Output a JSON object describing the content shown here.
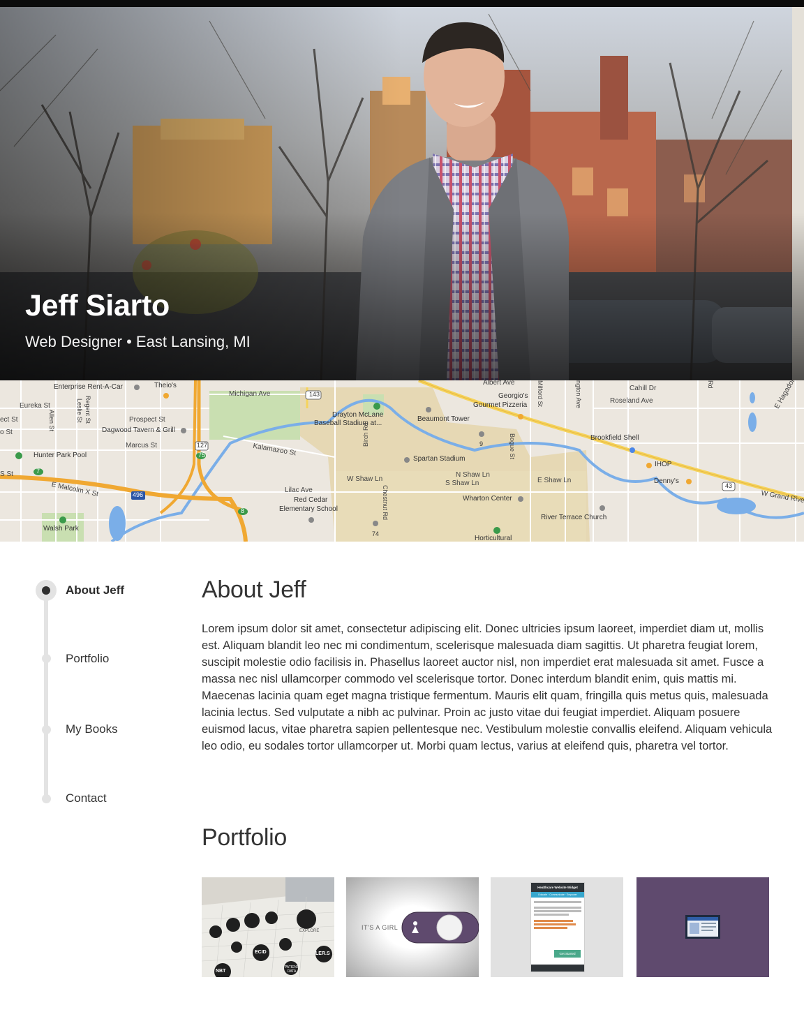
{
  "hero": {
    "name": "Jeff Siarto",
    "subtitle": "Web Designer • East Lansing, MI"
  },
  "map": {
    "labels": {
      "enterprise": "Enterprise Rent-A-Car",
      "theios": "Theio's",
      "michigan_ave": "Michigan Ave",
      "route_143": "143",
      "albert_ave": "Albert Ave",
      "georgios": "Georgio's",
      "gourmet_pizzeria": "Gourmet Pizzeria",
      "cahill_dr": "Cahill Dr",
      "roseland_ave": "Roseland Ave",
      "hagadorn": "E Hagadorn",
      "eureka_st": "Eureka St",
      "allen_st": "Allen St",
      "regent_st": "Regent St",
      "leslie_st": "Leslie St",
      "ect_st": "ect St",
      "prospect_st": "Prospect St",
      "dagwood": "Dagwood Tavern & Grill",
      "marcus_st": "Marcus St",
      "drayton": "Drayton McLane",
      "baseball": "Baseball Stadium at...",
      "beaumont": "Beaumont Tower",
      "milford": "Milford St",
      "huntington": "ngton Ave",
      "rd": "Rd",
      "brookfield": "Brookfield Shell",
      "o_st": "o St",
      "kalamazoo": "Kalamazoo St",
      "route_127": "127",
      "hunter_park": "Hunter Park Pool",
      "birch_rd": "Birch Rd",
      "spartan": "Spartan Stadium",
      "bogue": "Bogue St",
      "ihop": "IHOP",
      "dennys": "Denny's",
      "route_43": "43",
      "w_grand_river": "W Grand River",
      "s_st": "S St",
      "route_75": "75",
      "route_7": "7",
      "e_malcolm": "E Malcolm X St",
      "route_496": "496",
      "lilac": "Lilac Ave",
      "red_cedar": "Red Cedar",
      "elementary": "Elementary School",
      "w_shaw": "W Shaw Ln",
      "n_shaw": "N Shaw Ln",
      "s_shaw": "S Shaw Ln",
      "e_shaw": "E Shaw Ln",
      "chestnut": "Chestnut Rd",
      "wharton": "Wharton Center",
      "river_terrace": "River Terrace Church",
      "walsh_park": "Walsh Park",
      "route_8": "8",
      "route_74": "74",
      "route_9": "9",
      "horticultural": "Horticultural"
    }
  },
  "nav": {
    "items": [
      {
        "label": "About Jeff"
      },
      {
        "label": "Portfolio"
      },
      {
        "label": "My Books"
      },
      {
        "label": "Contact"
      }
    ]
  },
  "about": {
    "title": "About Jeff",
    "body": "Lorem ipsum dolor sit amet, consectetur adipiscing elit. Donec ultricies ipsum laoreet, imperdiet diam ut, mollis est. Aliquam blandit leo nec mi condimentum, scelerisque malesuada diam sagittis. Ut pharetra feugiat lorem, suscipit molestie odio facilisis in. Phasellus laoreet auctor nisl, non imperdiet erat malesuada sit amet. Fusce a massa nec nisl ullamcorper commodo vel scelerisque tortor. Donec interdum blandit enim, quis mattis mi. Maecenas lacinia quam eget magna tristique fermentum. Mauris elit quam, fringilla quis metus quis, malesuada lacinia lectus. Sed vulputate a nibh ac pulvinar. Proin ac justo vitae dui feugiat imperdiet. Aliquam posuere euismod lacus, vitae pharetra sapien pellentesque nec. Vestibulum molestie convallis eleifend. Aliquam vehicula leo odio, eu sodales tortor ullamcorper ut. Morbi quam lectus, varius at eleifend quis, pharetra vel tortor."
  },
  "portfolio": {
    "title": "Portfolio",
    "items": [
      {
        "art": [
          "EXPLORE",
          "ECID",
          "LER.S",
          "NBT",
          "PATIENT DATA"
        ]
      },
      {
        "caption": "IT'S A GIRL"
      },
      {
        "widget_title": "Healthcare Website Widget",
        "widget_tab": "Educate · Communicate · Empower",
        "widget_cta": "Get Started"
      },
      {}
    ]
  },
  "colors": {
    "accent_purple": "#5f4a6e",
    "timeline_gray": "#e3e3e3",
    "map_road_orange": "#f0a832",
    "map_road_yellow": "#f5d35b",
    "map_water": "#7aaee8",
    "map_campus": "#e6d8b4",
    "map_park": "#c9dfb1"
  }
}
